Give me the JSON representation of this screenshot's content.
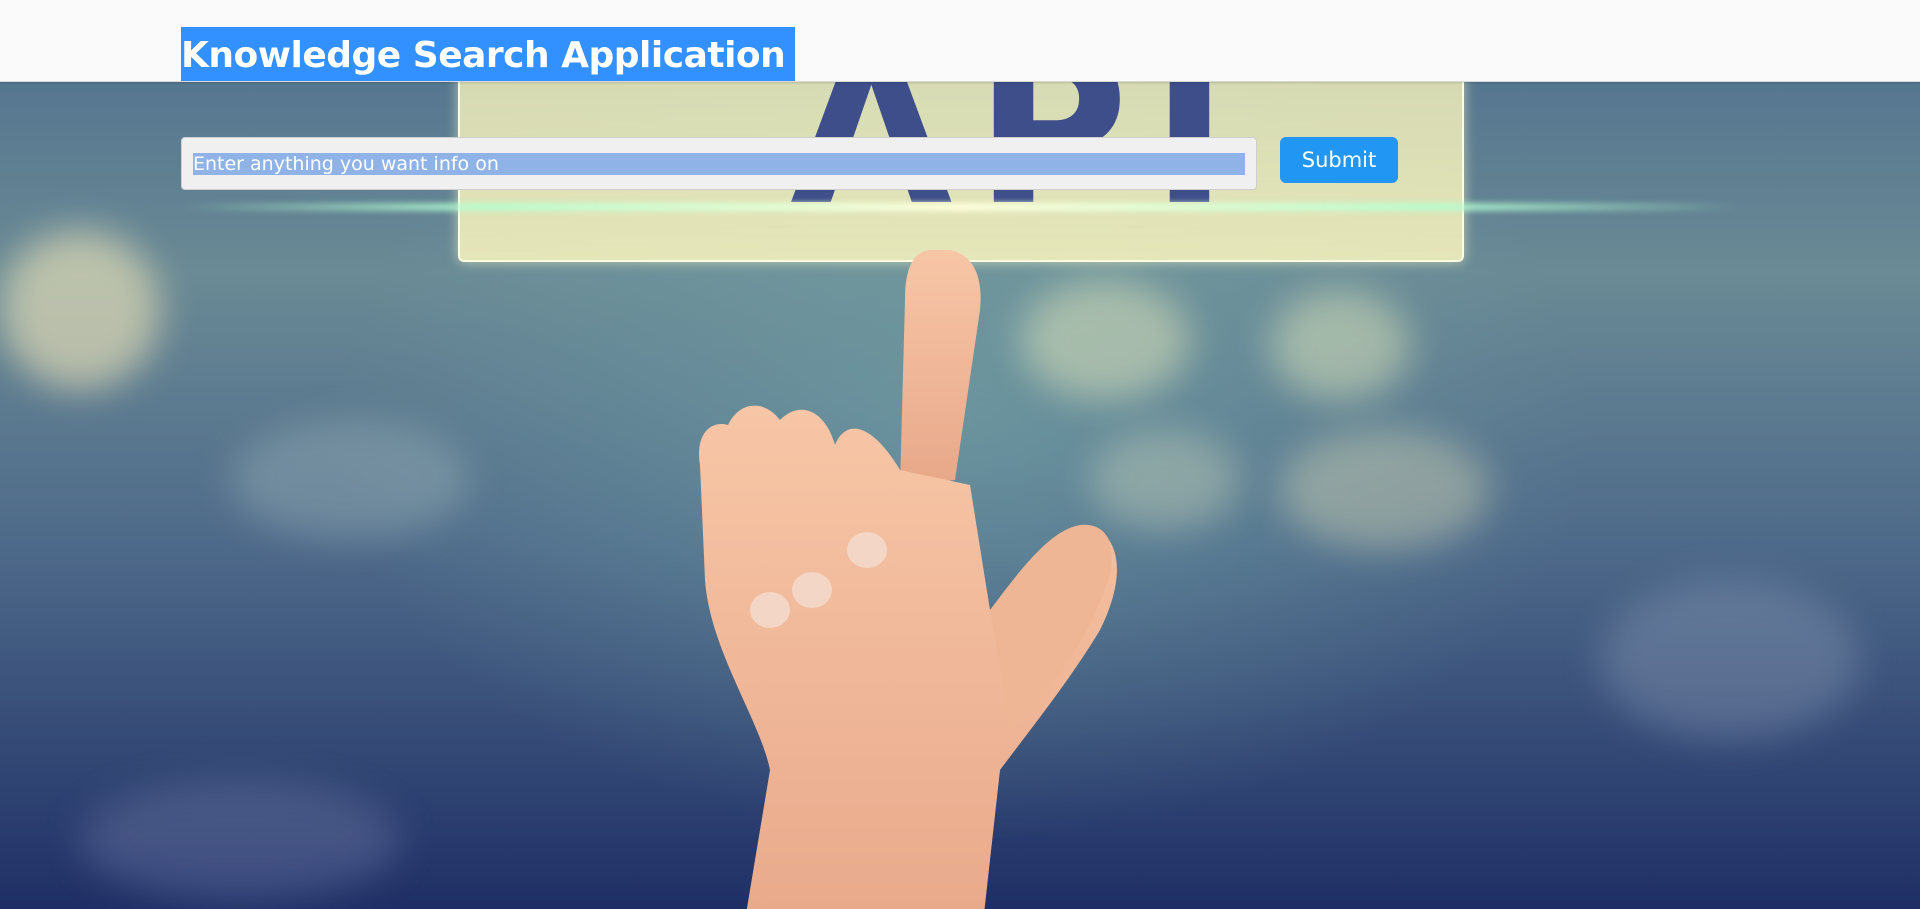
{
  "header": {
    "title": "Knowledge Search Application"
  },
  "search": {
    "placeholder": "Enter anything you want info on",
    "value": "",
    "submit_label": "Submit"
  },
  "background": {
    "panel_text": "API",
    "colors": {
      "header_bg": "#fafafa",
      "title_highlight": "#3390ff",
      "submit_button": "#2196f3",
      "input_bg": "#f0f0f0"
    }
  }
}
